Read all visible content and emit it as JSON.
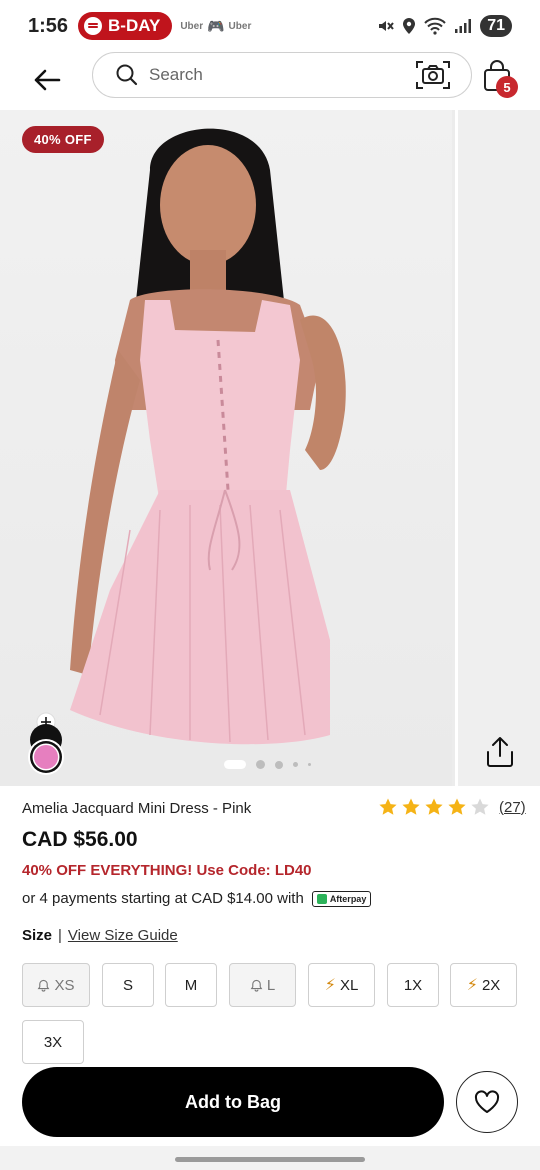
{
  "status_bar": {
    "time": "1:56",
    "spotify_label": "B-DAY",
    "app_1": "Uber",
    "app_2": "Uber",
    "battery": "71"
  },
  "header": {
    "search_placeholder": "Search",
    "bag_count": "5"
  },
  "gallery": {
    "sale_badge": "40% OFF",
    "image_count": 5,
    "active_image_index": 0,
    "swatch_color": "#e67fbf"
  },
  "product": {
    "title": "Amelia Jacquard Mini Dress - Pink",
    "rating_stars": 4,
    "rating_max": 5,
    "rating_count": "(27)",
    "price": "CAD $56.00",
    "promo": "40% OFF EVERYTHING! Use Code: LD40",
    "installments": "or 4 payments starting at CAD $14.00 with",
    "afterpay_label": "Afterpay"
  },
  "size": {
    "label": "Size",
    "guide_link": "View Size Guide",
    "options": [
      {
        "label": "XS",
        "state": "notify"
      },
      {
        "label": "S",
        "state": "available"
      },
      {
        "label": "M",
        "state": "available"
      },
      {
        "label": "L",
        "state": "notify"
      },
      {
        "label": "XL",
        "state": "low-stock"
      },
      {
        "label": "1X",
        "state": "available"
      },
      {
        "label": "2X",
        "state": "low-stock"
      },
      {
        "label": "3X",
        "state": "available"
      }
    ]
  },
  "actions": {
    "add_to_bag": "Add to Bag"
  },
  "colors": {
    "accent_red": "#b5262c",
    "badge_red": "#a8202a",
    "star_gold": "#f5b316",
    "primary_button": "#000000"
  }
}
